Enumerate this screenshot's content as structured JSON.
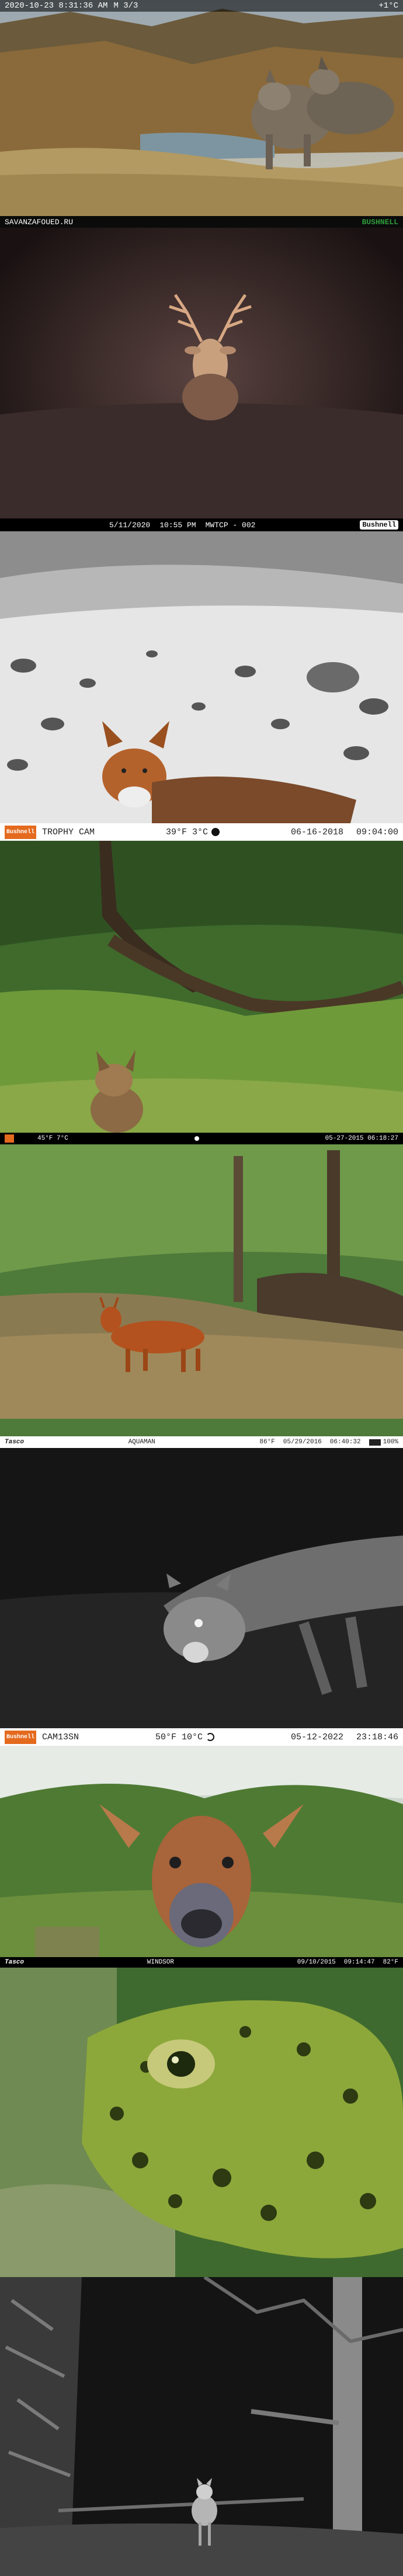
{
  "panels": [
    {
      "id": 1,
      "overlay_top": {
        "datetime": "2020-10-23  8:31:36 AM",
        "sequence": "M 3/3",
        "temperature": "+1°C"
      }
    },
    {
      "id": 2,
      "watermark_left": "SAVANZAFOUED.RU",
      "brand_right": "BUSHNELL",
      "overlay_bottom": {
        "date": "5/11/2020",
        "time": "10:55 PM",
        "camera": "MWTCP - 002",
        "brand": "Bushnell"
      }
    },
    {
      "id": 3,
      "overlay_bottom": {
        "brand": "Bushnell",
        "camera": "TROPHY CAM",
        "temperature": "39°F 3°C",
        "date": "06-16-2018",
        "time": "09:04:00"
      }
    },
    {
      "id": 4,
      "overlay_bottom": {
        "temperature": "45°F 7°C",
        "datetime": "05-27-2015 06:18:27"
      }
    },
    {
      "id": 5,
      "overlay_bottom": {
        "brand": "Tasco",
        "label": "AQUAMAN",
        "temperature": "86°F",
        "date": "05/29/2016",
        "time": "06:40:32",
        "battery": "100%"
      }
    },
    {
      "id": 6,
      "overlay_bottom": {
        "brand": "Bushnell",
        "camera": "CAM13SN",
        "temperature": "50°F 10°C",
        "date": "05-12-2022",
        "time": "23:18:46"
      }
    },
    {
      "id": 7,
      "overlay_bottom": {
        "brand": "Tasco",
        "label": "WINDSOR",
        "date": "09/10/2015",
        "time": "09:14:47",
        "temperature": "82°F"
      }
    },
    {
      "id": 8
    },
    {
      "id": 9
    }
  ]
}
